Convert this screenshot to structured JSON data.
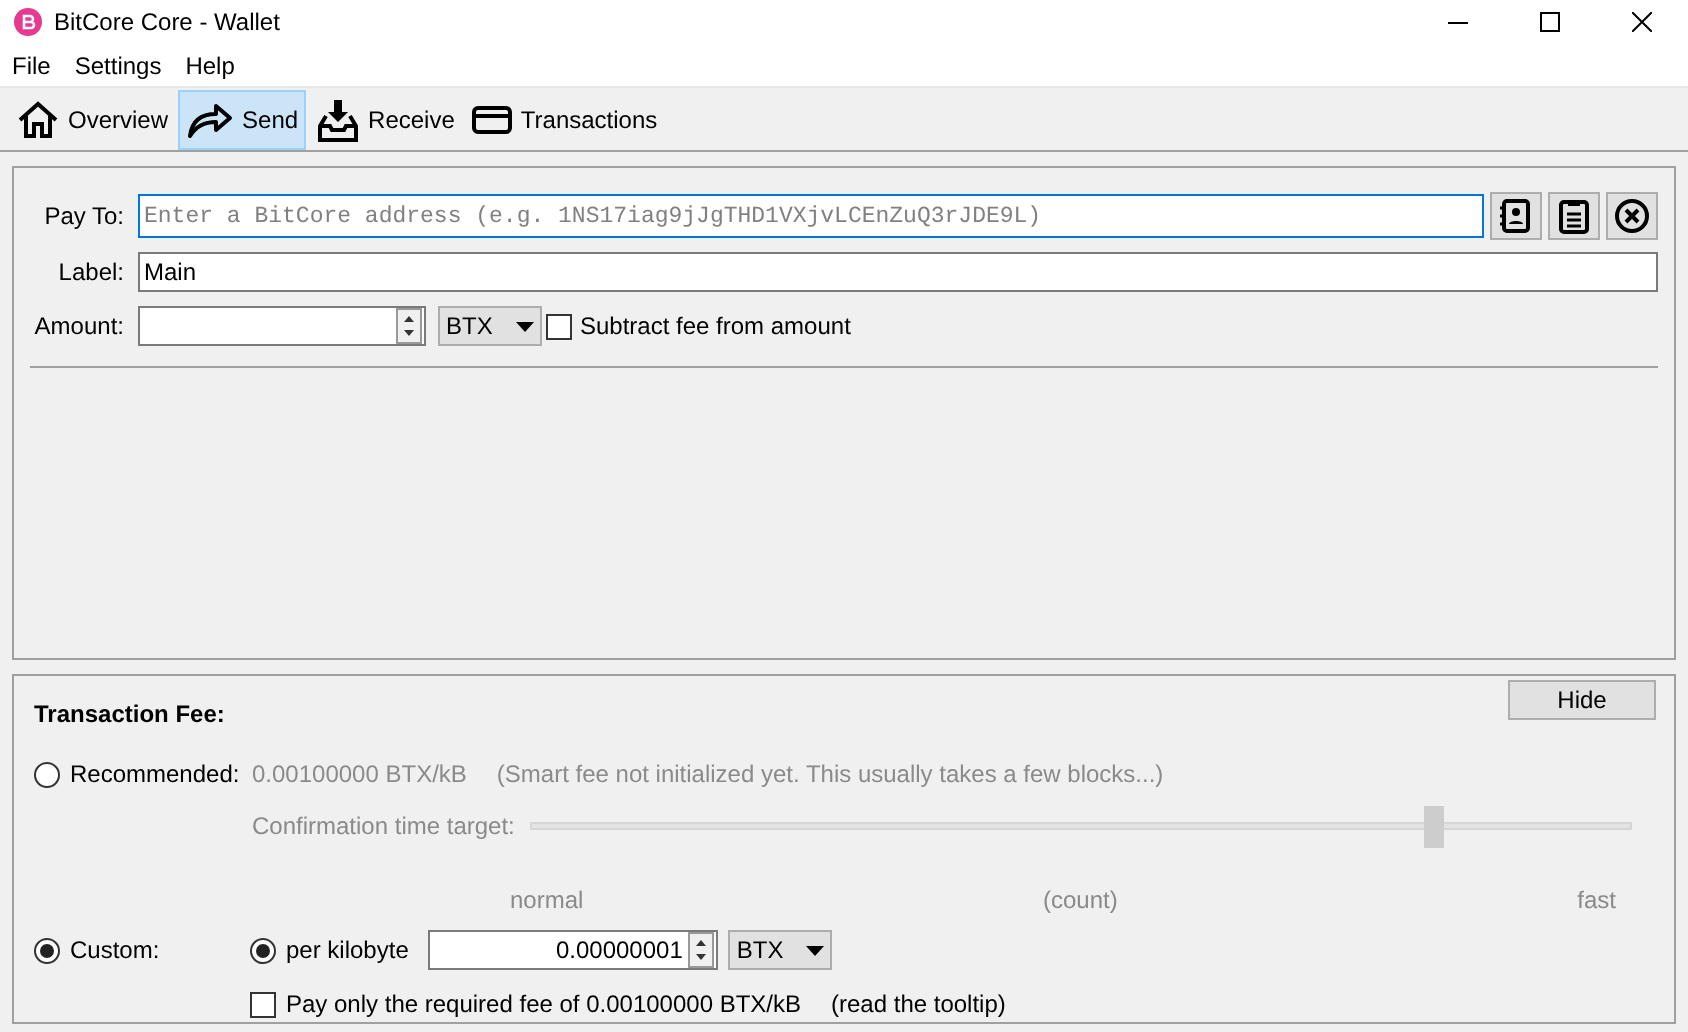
{
  "window": {
    "title": "BitCore Core - Wallet"
  },
  "menu": [
    "File",
    "Settings",
    "Help"
  ],
  "tabs": [
    {
      "label": "Overview",
      "selected": false,
      "kind": "home"
    },
    {
      "label": "Send",
      "selected": true,
      "kind": "send"
    },
    {
      "label": "Receive",
      "selected": false,
      "kind": "receive"
    },
    {
      "label": "Transactions",
      "selected": false,
      "kind": "card"
    }
  ],
  "pay_to": {
    "label": "Pay To:",
    "placeholder": "Enter a BitCore address (e.g. 1NS17iag9jJgTHD1VXjvLCEnZuQ3rJDE9L)"
  },
  "label_field": {
    "label": "Label:",
    "value": "Main"
  },
  "amount": {
    "label": "Amount:",
    "unit": "BTX",
    "subtract_fee": {
      "label": "Subtract fee from amount",
      "checked": false
    }
  },
  "fee": {
    "title": "Transaction Fee:",
    "hide_button": "Hide",
    "recommended": {
      "label": "Recommended:",
      "selected": false,
      "disabled": true,
      "rate": "0.00100000 BTX/kB",
      "note": "(Smart fee not initialized yet. This usually takes a few blocks...)",
      "target_label": "Confirmation time target:",
      "level": 0.82,
      "ticks": [
        "normal",
        "(count)",
        "fast"
      ]
    },
    "custom": {
      "label": "Custom:",
      "selected": true,
      "per_kilobyte": {
        "label": "per kilobyte",
        "selected": true
      },
      "value": "0.00000001",
      "unit": "BTX",
      "required_fee": {
        "label": "Pay only the required fee of 0.00100000 BTX/kB",
        "checked": false,
        "hint": "(read the tooltip)"
      }
    }
  }
}
